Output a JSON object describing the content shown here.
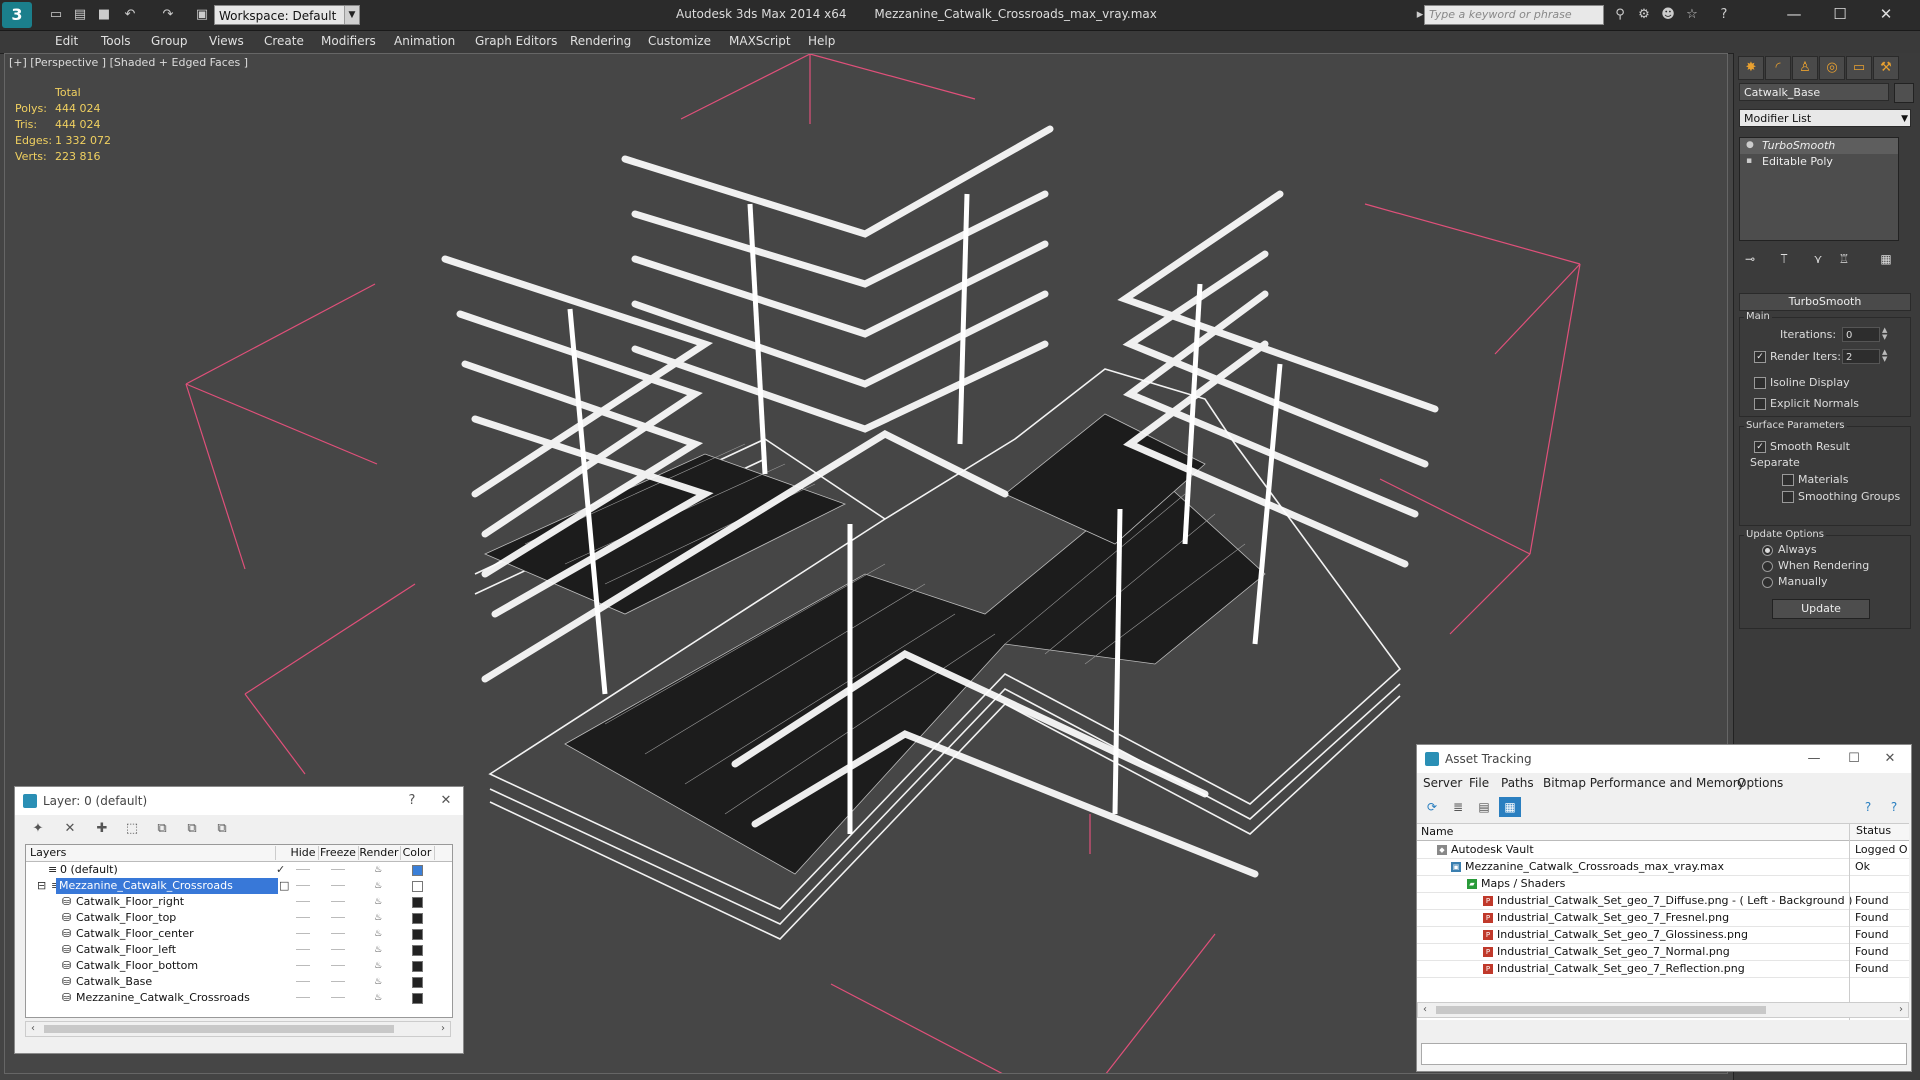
{
  "app": {
    "name": "Autodesk 3ds Max  2014 x64",
    "file": "Mezzanine_Catwalk_Crossroads_max_vray.max",
    "workspace": "Workspace: Default",
    "search_placeholder": "Type a keyword or phrase"
  },
  "menu": [
    "Edit",
    "Tools",
    "Group",
    "Views",
    "Create",
    "Modifiers",
    "Animation",
    "Graph Editors",
    "Rendering",
    "Customize",
    "MAXScript",
    "Help"
  ],
  "viewport": {
    "label": "[+] [Perspective ] [Shaded + Edged Faces ]",
    "stats_header": "Total",
    "stats": [
      {
        "k": "Polys:",
        "v": "444 024"
      },
      {
        "k": "Tris:",
        "v": "444 024"
      },
      {
        "k": "Edges:",
        "v": "1 332 072"
      },
      {
        "k": "Verts:",
        "v": "223 816"
      }
    ]
  },
  "command_panel": {
    "object_name": "Catwalk_Base",
    "modifier_list": "Modifier List",
    "stack": [
      "TurboSmooth",
      "Editable Poly"
    ],
    "rollout": "TurboSmooth",
    "main_group": "Main",
    "iterations_label": "Iterations:",
    "iterations_value": "0",
    "render_iters_label": "Render Iters:",
    "render_iters_value": "2",
    "isoline": "Isoline Display",
    "explicit_normals": "Explicit Normals",
    "surface_params": "Surface Parameters",
    "smooth_result": "Smooth Result",
    "separate": "Separate",
    "materials": "Materials",
    "smoothing_groups": "Smoothing Groups",
    "update_options": "Update Options",
    "always": "Always",
    "when_rendering": "When Rendering",
    "manually": "Manually",
    "update_button": "Update"
  },
  "layer_window": {
    "title": "Layer: 0 (default)",
    "help": "?",
    "columns": [
      "Layers",
      "Hide",
      "Freeze",
      "Render",
      "Color"
    ],
    "rows": [
      {
        "name": "0 (default)",
        "color": "#3a7fd8"
      },
      {
        "name": "Mezzanine_Catwalk_Crossroads",
        "color": "#ffffff"
      },
      {
        "name": "Catwalk_Floor_right",
        "color": "#222222"
      },
      {
        "name": "Catwalk_Floor_top",
        "color": "#222222"
      },
      {
        "name": "Catwalk_Floor_center",
        "color": "#222222"
      },
      {
        "name": "Catwalk_Floor_left",
        "color": "#222222"
      },
      {
        "name": "Catwalk_Floor_bottom",
        "color": "#222222"
      },
      {
        "name": "Catwalk_Base",
        "color": "#222222"
      },
      {
        "name": "Mezzanine_Catwalk_Crossroads",
        "color": "#222222"
      }
    ]
  },
  "asset_window": {
    "title": "Asset Tracking",
    "menu": [
      "Server",
      "File",
      "Paths",
      "Bitmap Performance and Memory",
      "Options"
    ],
    "columns": [
      "Name",
      "Status"
    ],
    "rows": [
      {
        "name": "Autodesk Vault",
        "status": "Logged O"
      },
      {
        "name": "Mezzanine_Catwalk_Crossroads_max_vray.max",
        "status": "Ok"
      },
      {
        "name": "Maps / Shaders",
        "status": ""
      },
      {
        "name": "Industrial_Catwalk_Set_geo_7_Diffuse.png - ( Left - Background )",
        "status": "Found"
      },
      {
        "name": "Industrial_Catwalk_Set_geo_7_Fresnel.png",
        "status": "Found"
      },
      {
        "name": "Industrial_Catwalk_Set_geo_7_Glossiness.png",
        "status": "Found"
      },
      {
        "name": "Industrial_Catwalk_Set_geo_7_Normal.png",
        "status": "Found"
      },
      {
        "name": "Industrial_Catwalk_Set_geo_7_Reflection.png",
        "status": "Found"
      }
    ]
  },
  "colors": {
    "accent": "#e8a030",
    "selection": "#3878d8",
    "stats": "#f0d060",
    "bbox": "#e0507a"
  }
}
